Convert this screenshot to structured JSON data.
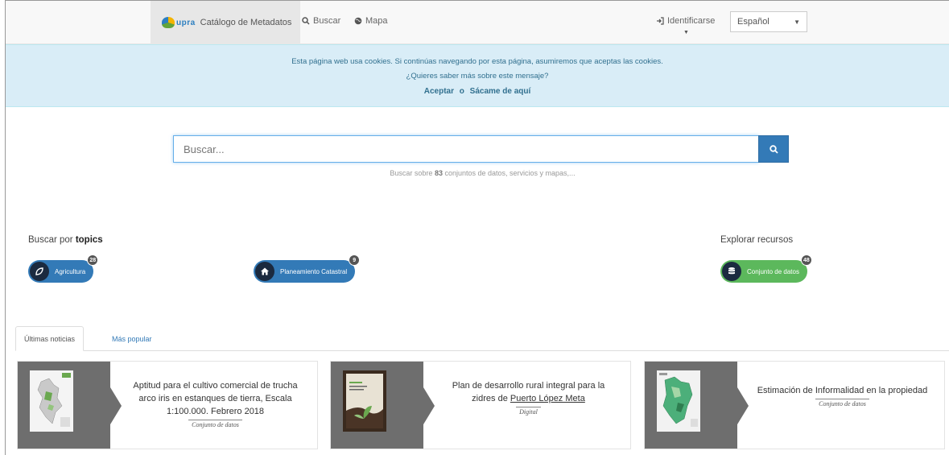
{
  "navbar": {
    "brand_logo_text": "upra",
    "brand_label": "Catálogo de Metadatos",
    "buscar_label": "Buscar",
    "mapa_label": "Mapa",
    "identificarse_label": "Identificarse",
    "language_selected": "Español"
  },
  "cookie_banner": {
    "line1": "Esta página web usa cookies. Si continúas navegando por esta página, asumiremos que aceptas las cookies.",
    "line2": "¿Quieres saber más sobre este mensaje?",
    "accept_label": "Aceptar",
    "or_label": "o",
    "leave_label": "Sácame de aquí"
  },
  "search": {
    "placeholder": "Buscar...",
    "hint_prefix": "Buscar sobre",
    "hint_count": "83",
    "hint_suffix": "conjuntos de datos, servicios y mapas,..."
  },
  "topics": {
    "title_prefix": "Buscar por",
    "title_bold": "topics",
    "items": [
      {
        "label": "Agricultura",
        "count": "28",
        "icon": "leaf-icon"
      },
      {
        "label": "Planeamiento Catastral",
        "count": "9",
        "icon": "home-icon"
      }
    ]
  },
  "resources": {
    "title": "Explorar recursos",
    "items": [
      {
        "label": "Conjunto de datos",
        "count": "48",
        "icon": "database-icon"
      }
    ]
  },
  "tabs": [
    {
      "label": "Últimas noticias",
      "active": true
    },
    {
      "label": "Más popular",
      "active": false
    }
  ],
  "cards": [
    {
      "line1": "Aptitud para el cultivo comercial de trucha",
      "line2": "arco iris en estanques de tierra, Escala",
      "line3": "1:100.000. Febrero 2018",
      "type": "Conjunto de datos"
    },
    {
      "line1": "Plan de desarrollo rural integral para la",
      "line2_a": "zidres de",
      "line2_b": "Puerto López Meta",
      "type": "Digital"
    },
    {
      "line1": "Estimación de Informalidad en la propiedad",
      "type": "Conjunto de datos"
    }
  ],
  "colors": {
    "primary": "#337ab7",
    "success": "#5cb85c",
    "cookie_bg": "#d9edf7",
    "card_thumb_bg": "#6e6e6e"
  }
}
